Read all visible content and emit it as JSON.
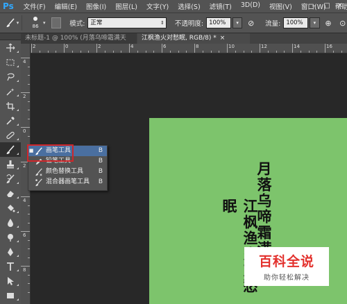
{
  "app": {
    "logo": "Ps"
  },
  "menu": {
    "items": [
      "文件(F)",
      "编辑(E)",
      "图像(I)",
      "图层(L)",
      "文字(Y)",
      "选择(S)",
      "滤镜(T)",
      "3D(D)",
      "视图(V)",
      "窗口(W)",
      "帮助"
    ]
  },
  "window_controls": {
    "minimize": "–",
    "maximize": "□",
    "close": "✕"
  },
  "options": {
    "brush_size": "86",
    "mode_label": "模式:",
    "mode_value": "正常",
    "opacity_label": "不透明度:",
    "opacity_value": "100%",
    "flow_label": "流量:",
    "flow_value": "100%"
  },
  "tabs": [
    {
      "label": "未标题-1 @ 100% (月落乌啼霜满天",
      "active": false
    },
    {
      "label": "江枫渔火对愁眠, RGB/8) *",
      "active": true
    }
  ],
  "tab_close": "×",
  "rulers": {
    "horizontal": [
      "2",
      "0",
      "2",
      "4",
      "6",
      "8",
      "10",
      "12",
      "14",
      "16"
    ],
    "vertical": [
      "4",
      "2",
      "0",
      "2",
      "4",
      "6",
      "8"
    ]
  },
  "flyout": {
    "items": [
      {
        "label": "画笔工具",
        "key": "B",
        "icon": "brush-icon",
        "selected": true
      },
      {
        "label": "铅笔工具",
        "key": "B",
        "icon": "pencil-icon",
        "selected": false
      },
      {
        "label": "颜色替换工具",
        "key": "B",
        "icon": "color-replacement-icon",
        "selected": false
      },
      {
        "label": "混合器画笔工具",
        "key": "B",
        "icon": "mixer-brush-icon",
        "selected": false
      }
    ]
  },
  "canvas": {
    "color": "#7dc46c",
    "poem_line_1": "月落乌啼霜满天",
    "poem_line_2": "江枫渔火对愁眠"
  },
  "watermark": {
    "title": "百科全说",
    "subtitle": "助你轻松解决"
  },
  "colors": {
    "accent": "#31a8ff",
    "highlight_box": "#d0262a",
    "watermark_red": "#e3312d"
  }
}
